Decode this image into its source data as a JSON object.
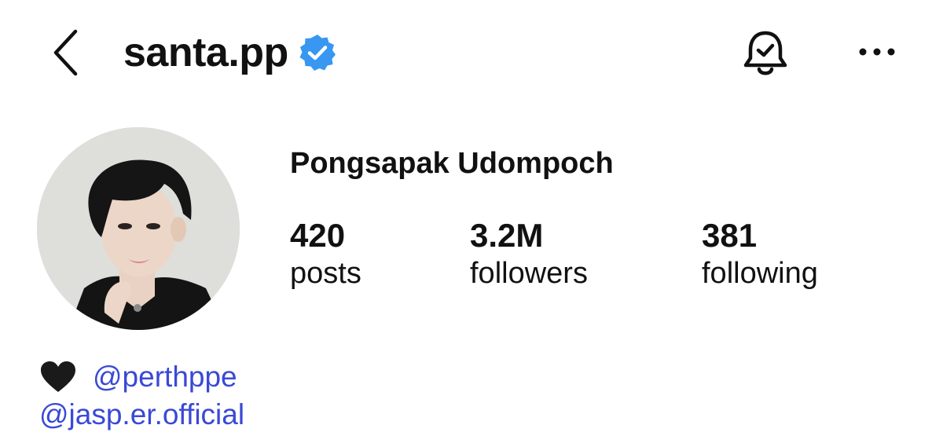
{
  "header": {
    "username": "santa.pp",
    "verified_icon": "verified-badge-icon",
    "back_icon": "chevron-left-icon",
    "bell_icon": "notification-bell-icon",
    "more_icon": "ellipsis-icon"
  },
  "profile": {
    "full_name": "Pongsapak Udompoch",
    "stats": [
      {
        "value": "420",
        "label": "posts"
      },
      {
        "value": "3.2M",
        "label": "followers"
      },
      {
        "value": "381",
        "label": "following"
      }
    ]
  },
  "bio": {
    "emoji": "black-heart-icon",
    "mentions": [
      "@perthppe",
      "@jasp.er.official"
    ]
  },
  "colors": {
    "verified": "#3897f0",
    "mention": "#3a49d6",
    "text": "#111111"
  }
}
